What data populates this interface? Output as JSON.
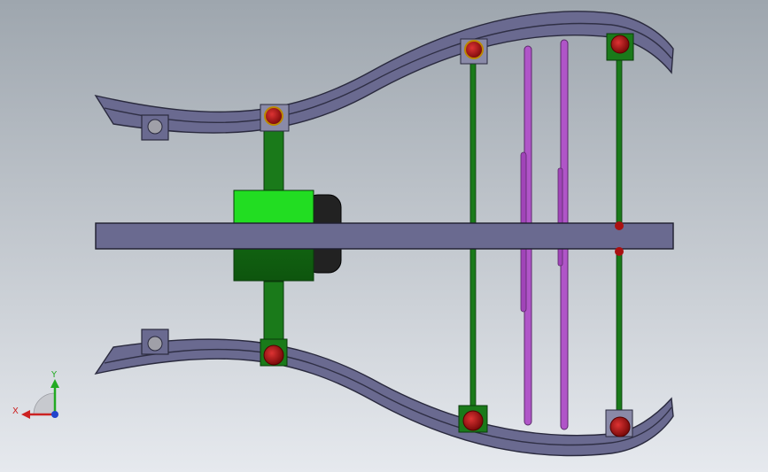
{
  "viewport": {
    "background_top": "#9ea6ae",
    "background_bottom": "#e6e9ee"
  },
  "triad": {
    "x_label": "X",
    "y_label": "Y",
    "x_color": "#cc2222",
    "y_color": "#22aa22",
    "z_color": "#2244cc"
  },
  "colors": {
    "frame": "#6a6a90",
    "frame_edge": "#2a2a3e",
    "rail_edge": "#2f2f45",
    "link_green": "#1a7a1a",
    "cylinder_light": "#22dd22",
    "cylinder_dark": "#116611",
    "pivot_red": "#aa1111",
    "rod_purple": "#b055c8",
    "knob_dark": "#333333",
    "hole_gray": "#a0a0a8"
  }
}
